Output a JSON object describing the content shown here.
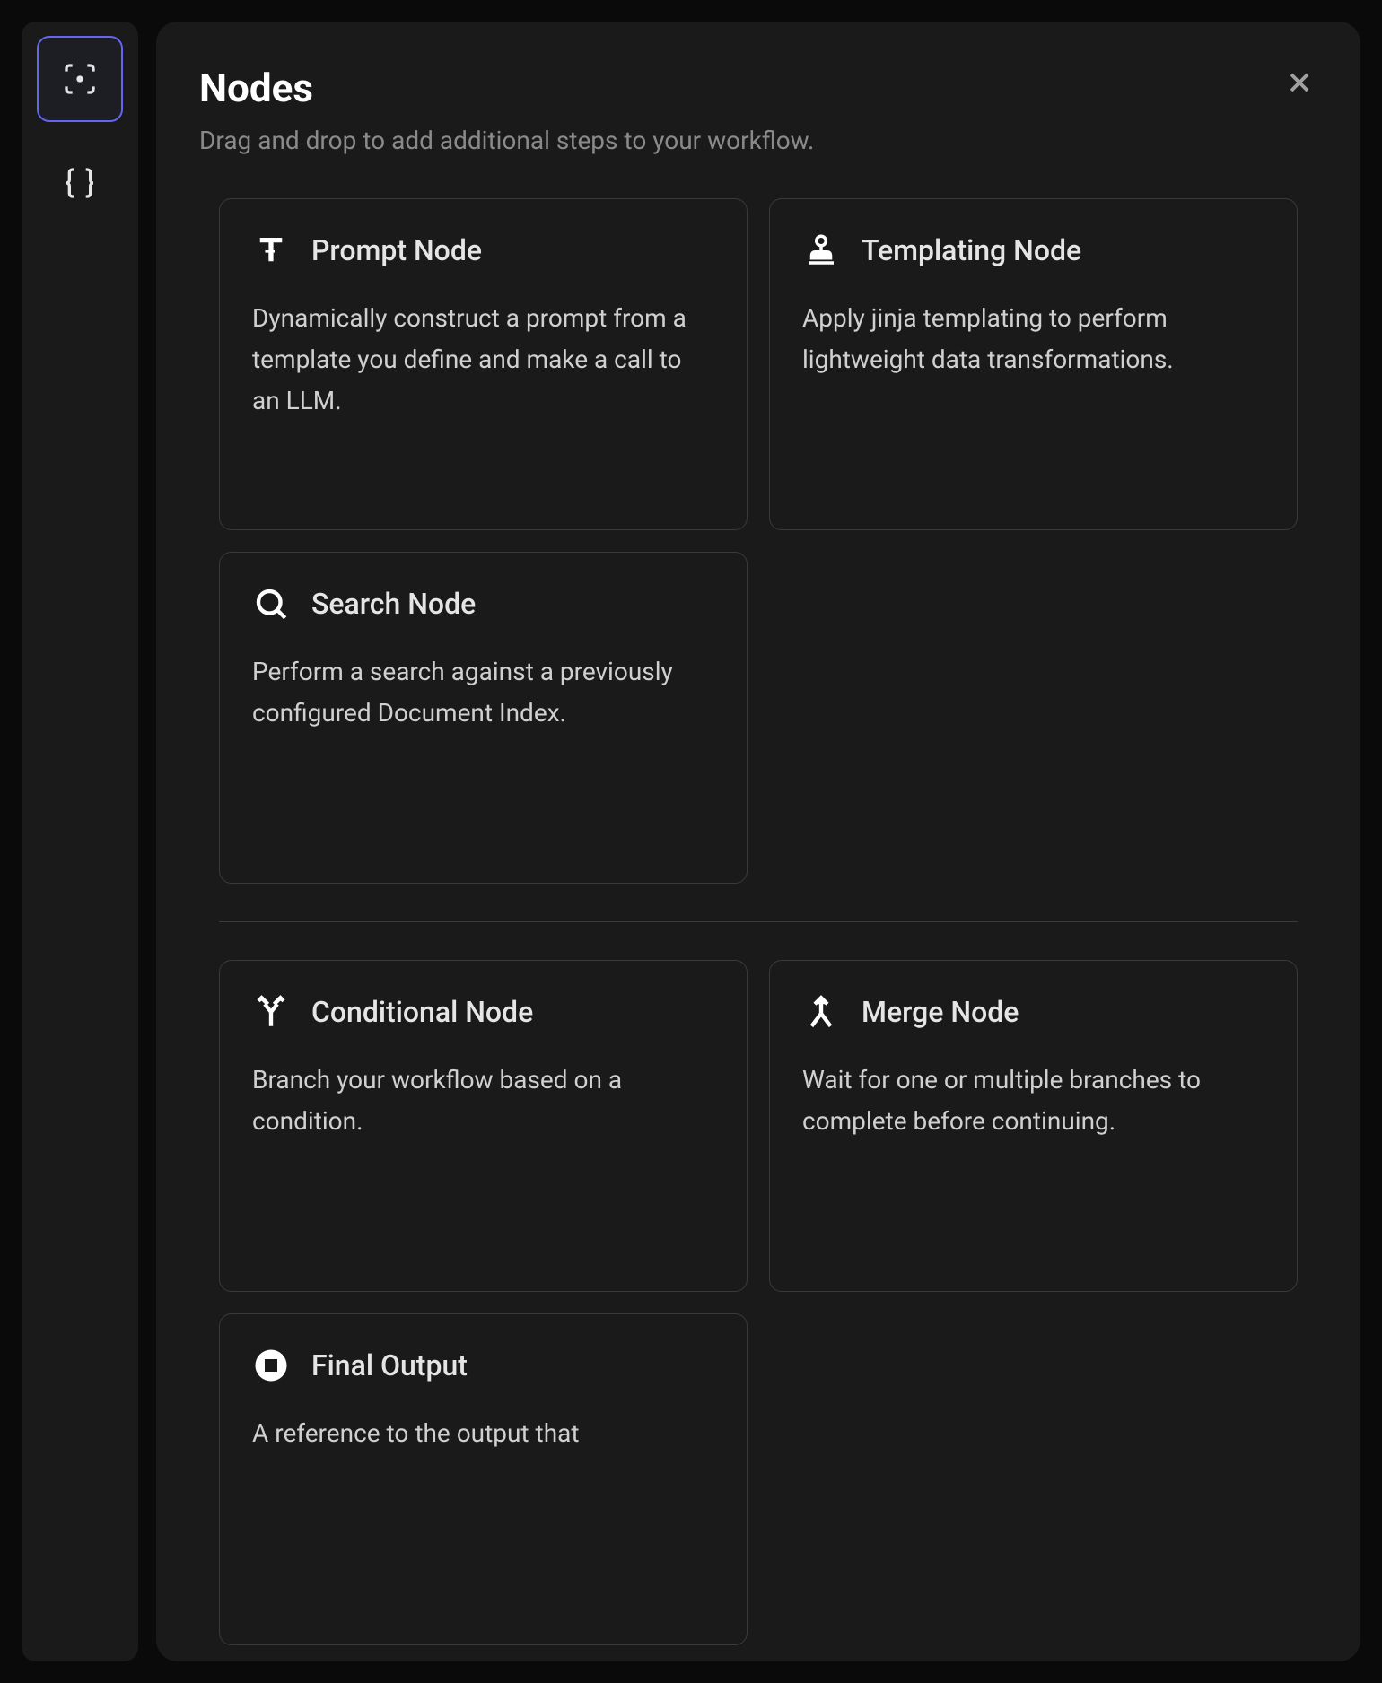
{
  "panel": {
    "title": "Nodes",
    "subtitle": "Drag and drop to add additional steps to your workflow."
  },
  "sidebar": {
    "items": [
      {
        "name": "focus-icon",
        "active": true
      },
      {
        "name": "braces-icon",
        "active": false
      }
    ]
  },
  "groups": [
    {
      "nodes": [
        {
          "id": "prompt",
          "title": "Prompt Node",
          "description": "Dynamically construct a prompt from a template you define and make a call to an LLM.",
          "icon": "text-icon"
        },
        {
          "id": "templating",
          "title": "Templating Node",
          "description": "Apply jinja templating to perform lightweight data transformations.",
          "icon": "stamp-icon"
        },
        {
          "id": "search",
          "title": "Search Node",
          "description": "Perform a search against a previously configured Document Index.",
          "icon": "search-icon"
        }
      ]
    },
    {
      "nodes": [
        {
          "id": "conditional",
          "title": "Conditional Node",
          "description": "Branch your workflow based on a condition.",
          "icon": "branch-icon"
        },
        {
          "id": "merge",
          "title": "Merge Node",
          "description": "Wait for one or multiple branches to complete before continuing.",
          "icon": "merge-icon"
        },
        {
          "id": "final-output",
          "title": "Final Output",
          "description": "A reference to the output that",
          "icon": "stop-icon"
        }
      ]
    }
  ]
}
